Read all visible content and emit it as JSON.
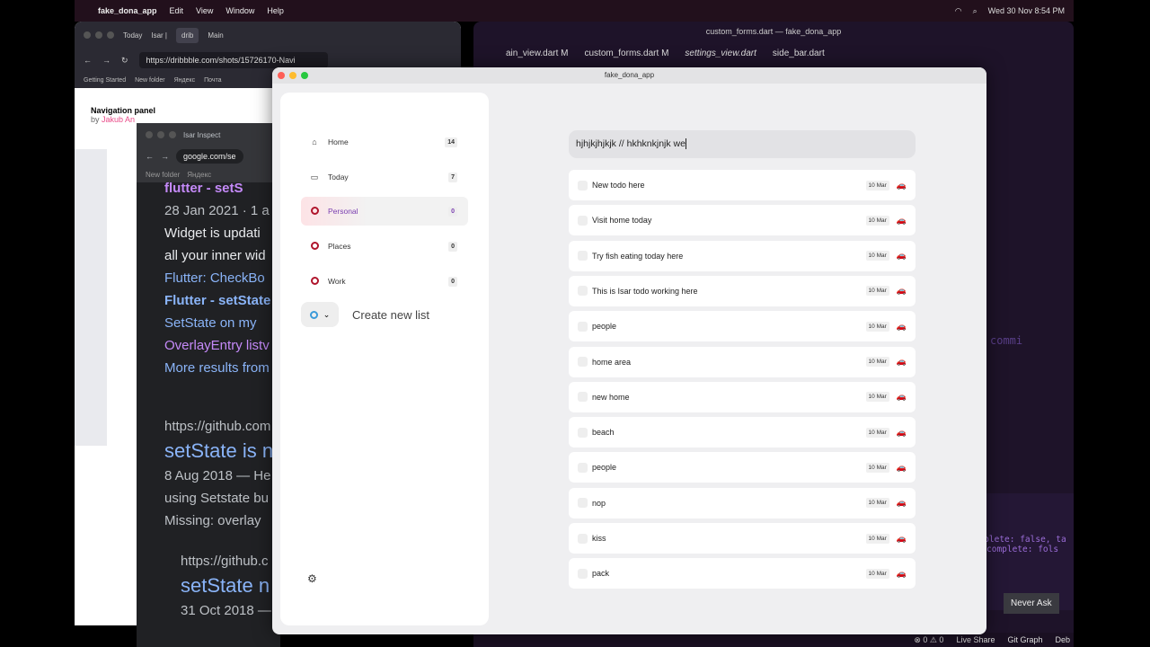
{
  "menubar": {
    "app": "fake_dona_app",
    "items": [
      "Edit",
      "View",
      "Window",
      "Help"
    ],
    "clock": "Wed 30 Nov  8:54 PM"
  },
  "firefox": {
    "tabs": [
      "Today",
      "Isar |",
      "drib",
      "Main"
    ],
    "url": "https://dribbble.com/shots/15726170-Navi",
    "bookmarks": [
      "Getting Started",
      "New folder",
      "Яндекс",
      "Почта"
    ],
    "shot_title": "Navigation panel",
    "shot_by": "by",
    "shot_author": "Jakub An"
  },
  "chrome": {
    "tab": "Isar Inspect",
    "url": "google.com/se",
    "bookmarks": [
      "New folder",
      "Яндекс"
    ],
    "results": [
      "flutter - setS",
      "28 Jan 2021 · 1 a",
      "Widget is updati",
      "all your inner wid",
      "Flutter: CheckBo",
      "Flutter - setState",
      "SetState on my",
      "OverlayEntry listv",
      "More results from",
      "https://github.com",
      "setState is n",
      "8 Aug 2018 — He",
      "using Setstate bu",
      "Missing: overlay",
      "https://github.c",
      "setState n",
      "31 Oct 2018 —"
    ]
  },
  "vscode": {
    "title": "custom_forms.dart — fake_dona_app",
    "tabs": [
      "ain_view.dart M",
      "custom_forms.dart M",
      "settings_view.dart",
      "side_bar.dart"
    ],
    "code": [
      "complete: false, ta",
      "complete: fols"
    ],
    "never_ask": "Never Ask",
    "status": [
      "⊗ 0 ⚠ 0",
      "Live Share",
      "Git Graph",
      "Deb"
    ],
    "minimap_word": "commi"
  },
  "app": {
    "title": "fake_dona_app",
    "sidebar": [
      {
        "label": "Home",
        "count": "14",
        "icon": "home-icon"
      },
      {
        "label": "Today",
        "count": "7",
        "icon": "calendar-icon"
      },
      {
        "label": "Personal",
        "count": "0",
        "icon": "ring-icon"
      },
      {
        "label": "Places",
        "count": "0",
        "icon": "ring-icon"
      },
      {
        "label": "Work",
        "count": "0",
        "icon": "ring-icon"
      }
    ],
    "active": "Personal",
    "create_label": "Create new list",
    "accent": "#b0152c",
    "input_value": "hjhjkjhjkjk // hkhknkjnjk we",
    "todos": [
      {
        "t": "New todo here",
        "d": "10 Mar"
      },
      {
        "t": "Visit home today",
        "d": "10 Mar"
      },
      {
        "t": "Try fish eating today here",
        "d": "10 Mar"
      },
      {
        "t": "This is Isar todo working here",
        "d": "10 Mar"
      },
      {
        "t": "people",
        "d": "10 Mar"
      },
      {
        "t": "home area",
        "d": "10 Mar"
      },
      {
        "t": "new home",
        "d": "10 Mar"
      },
      {
        "t": "beach",
        "d": "10 Mar"
      },
      {
        "t": "people",
        "d": "10 Mar"
      },
      {
        "t": "nop",
        "d": "10 Mar"
      },
      {
        "t": "kiss",
        "d": "10 Mar"
      },
      {
        "t": "pack",
        "d": "10 Mar"
      }
    ]
  }
}
